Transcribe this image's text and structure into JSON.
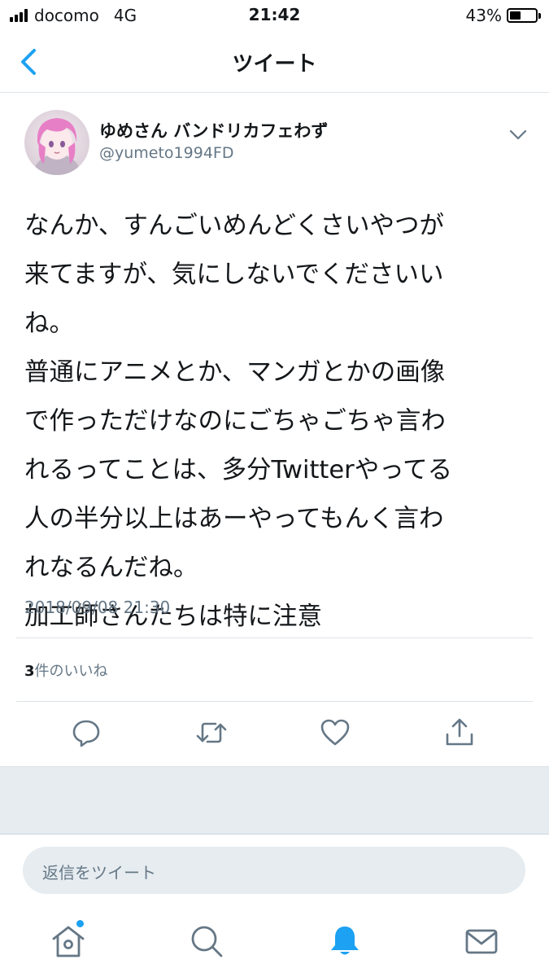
{
  "status_bar": {
    "carrier": "docomo",
    "network": "4G",
    "time": "21:42",
    "battery_percent": "43%",
    "battery_level": 0.43
  },
  "nav": {
    "title": "ツイート",
    "back_icon": "chevron-left-icon"
  },
  "tweet": {
    "display_name": "ゆめさん バンドリカフェわず",
    "handle": "@yumeto1994FD",
    "text_lines": [
      "なんか、すんごいめんどくさいやつが",
      "来てますが、気にしないでくださいい",
      "ね。",
      "普通にアニメとか、マンガとかの画像",
      "で作っただけなのにごちゃごちゃ言わ",
      "れるってことは、多分Twitterやってる",
      "人の半分以上はあーやってもんく言わ",
      "れなるんだね。",
      "加工師さんたちは特に注意"
    ],
    "timestamp": "2018/09/08 21:30",
    "likes_count": "3",
    "likes_label": "件のいいね"
  },
  "actions": [
    "reply-icon",
    "retweet-icon",
    "heart-icon",
    "share-icon"
  ],
  "reply": {
    "placeholder": "返信をツイート"
  },
  "tabs": [
    "home-icon",
    "search-icon",
    "notifications-icon",
    "messages-icon"
  ],
  "colors": {
    "accent": "#1da1f2",
    "icon_gray": "#657786",
    "band": "#e6ecf0",
    "active_tab": "#1da1f2"
  }
}
